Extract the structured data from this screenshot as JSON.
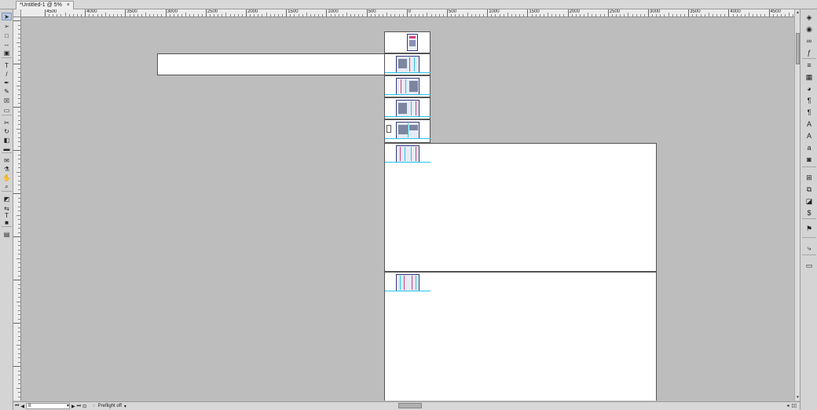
{
  "document": {
    "tab_title": "*Untitled-1 @ 5%",
    "close_glyph": "×"
  },
  "ruler": {
    "h_labels": [
      "4500",
      "4000",
      "3500",
      "3000",
      "2500",
      "2000",
      "1500",
      "1000",
      "500",
      "0",
      "500",
      "1000",
      "1500",
      "2000",
      "2500",
      "3000",
      "3500",
      "4000",
      "4500"
    ]
  },
  "tools": [
    {
      "name": "selection-tool-icon",
      "glyph": "➤"
    },
    {
      "name": "direct-selection-tool-icon",
      "glyph": "➢"
    },
    {
      "name": "page-tool-icon",
      "glyph": "□"
    },
    {
      "name": "gap-tool-icon",
      "glyph": "↔"
    },
    {
      "name": "content-collector-icon",
      "glyph": "▣"
    },
    {
      "name": "type-tool-icon",
      "glyph": "T"
    },
    {
      "name": "line-tool-icon",
      "glyph": "/"
    },
    {
      "name": "pen-tool-icon",
      "glyph": "✒"
    },
    {
      "name": "pencil-tool-icon",
      "glyph": "✎"
    },
    {
      "name": "rectangle-frame-tool-icon",
      "glyph": "☒"
    },
    {
      "name": "rectangle-tool-icon",
      "glyph": "▭"
    },
    {
      "name": "scissors-tool-icon",
      "glyph": "✂"
    },
    {
      "name": "free-transform-tool-icon",
      "glyph": "↻"
    },
    {
      "name": "gradient-swatch-tool-icon",
      "glyph": "◧"
    },
    {
      "name": "gradient-feather-tool-icon",
      "glyph": "▬"
    },
    {
      "name": "note-tool-icon",
      "glyph": "✉"
    },
    {
      "name": "eyedropper-tool-icon",
      "glyph": "⚗"
    },
    {
      "name": "hand-tool-icon",
      "glyph": "✋"
    },
    {
      "name": "zoom-tool-icon",
      "glyph": "⌕"
    },
    {
      "name": "fill-stroke-icon",
      "glyph": "◩"
    },
    {
      "name": "swap-fill-stroke-icon",
      "glyph": "⇆"
    },
    {
      "name": "formatting-container-icon",
      "glyph": "T"
    },
    {
      "name": "normal-view-mode-icon",
      "glyph": "■"
    },
    {
      "name": "screen-mode-icon",
      "glyph": "▤"
    }
  ],
  "dock": [
    {
      "name": "pages-panel-icon",
      "glyph": "◈"
    },
    {
      "name": "layers-panel-icon",
      "glyph": "◉"
    },
    {
      "name": "links-panel-icon",
      "glyph": "∞"
    },
    {
      "name": "effects-panel-icon",
      "glyph": "ƒ"
    },
    {
      "name": "stroke-panel-icon",
      "glyph": "≡"
    },
    {
      "name": "color-panel-icon",
      "glyph": "▦"
    },
    {
      "name": "swatches-panel-icon",
      "glyph": "◕"
    },
    {
      "name": "paragraph-panel-icon",
      "glyph": "¶"
    },
    {
      "name": "paragraph-styles-panel-icon",
      "glyph": "¶"
    },
    {
      "name": "character-panel-icon",
      "glyph": "A"
    },
    {
      "name": "character-styles-panel-icon",
      "glyph": "A"
    },
    {
      "name": "glyphs-panel-icon",
      "glyph": "a"
    },
    {
      "name": "object-styles-panel-icon",
      "glyph": "◙"
    },
    {
      "name": "align-panel-icon",
      "glyph": "⊞"
    },
    {
      "name": "pathfinder-panel-icon",
      "glyph": "⧉"
    },
    {
      "name": "transform-panel-icon",
      "glyph": "◪"
    },
    {
      "name": "text-wrap-panel-icon",
      "glyph": "$"
    },
    {
      "name": "table-panel-icon",
      "glyph": "⚑"
    },
    {
      "name": "hyperlinks-panel-icon",
      "glyph": "⤷"
    },
    {
      "name": "book-panel-icon",
      "glyph": "▭"
    }
  ],
  "status": {
    "page_number": "8",
    "preflight": "Preflight off"
  }
}
